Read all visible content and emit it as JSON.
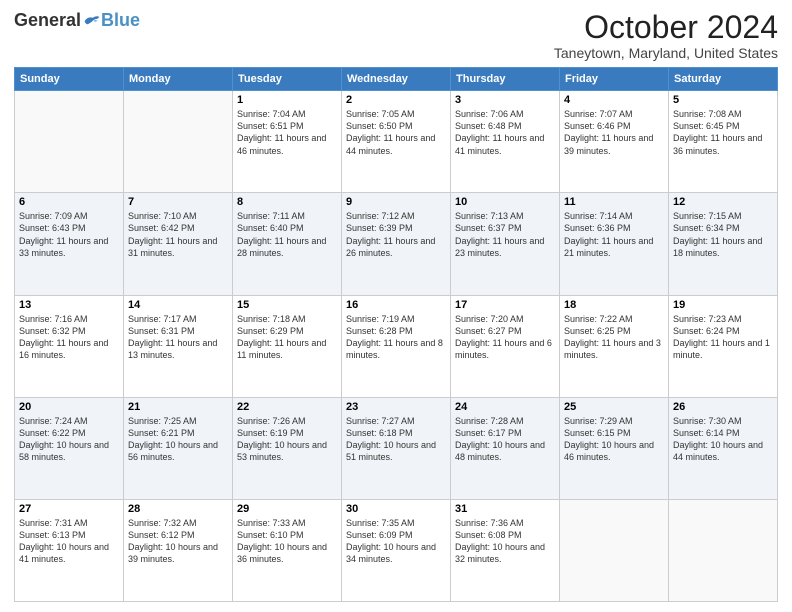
{
  "header": {
    "logo_general": "General",
    "logo_blue": "Blue",
    "month_title": "October 2024",
    "location": "Taneytown, Maryland, United States"
  },
  "calendar": {
    "days_of_week": [
      "Sunday",
      "Monday",
      "Tuesday",
      "Wednesday",
      "Thursday",
      "Friday",
      "Saturday"
    ],
    "weeks": [
      [
        {
          "day": "",
          "sunrise": "",
          "sunset": "",
          "daylight": ""
        },
        {
          "day": "",
          "sunrise": "",
          "sunset": "",
          "daylight": ""
        },
        {
          "day": "1",
          "sunrise": "Sunrise: 7:04 AM",
          "sunset": "Sunset: 6:51 PM",
          "daylight": "Daylight: 11 hours and 46 minutes."
        },
        {
          "day": "2",
          "sunrise": "Sunrise: 7:05 AM",
          "sunset": "Sunset: 6:50 PM",
          "daylight": "Daylight: 11 hours and 44 minutes."
        },
        {
          "day": "3",
          "sunrise": "Sunrise: 7:06 AM",
          "sunset": "Sunset: 6:48 PM",
          "daylight": "Daylight: 11 hours and 41 minutes."
        },
        {
          "day": "4",
          "sunrise": "Sunrise: 7:07 AM",
          "sunset": "Sunset: 6:46 PM",
          "daylight": "Daylight: 11 hours and 39 minutes."
        },
        {
          "day": "5",
          "sunrise": "Sunrise: 7:08 AM",
          "sunset": "Sunset: 6:45 PM",
          "daylight": "Daylight: 11 hours and 36 minutes."
        }
      ],
      [
        {
          "day": "6",
          "sunrise": "Sunrise: 7:09 AM",
          "sunset": "Sunset: 6:43 PM",
          "daylight": "Daylight: 11 hours and 33 minutes."
        },
        {
          "day": "7",
          "sunrise": "Sunrise: 7:10 AM",
          "sunset": "Sunset: 6:42 PM",
          "daylight": "Daylight: 11 hours and 31 minutes."
        },
        {
          "day": "8",
          "sunrise": "Sunrise: 7:11 AM",
          "sunset": "Sunset: 6:40 PM",
          "daylight": "Daylight: 11 hours and 28 minutes."
        },
        {
          "day": "9",
          "sunrise": "Sunrise: 7:12 AM",
          "sunset": "Sunset: 6:39 PM",
          "daylight": "Daylight: 11 hours and 26 minutes."
        },
        {
          "day": "10",
          "sunrise": "Sunrise: 7:13 AM",
          "sunset": "Sunset: 6:37 PM",
          "daylight": "Daylight: 11 hours and 23 minutes."
        },
        {
          "day": "11",
          "sunrise": "Sunrise: 7:14 AM",
          "sunset": "Sunset: 6:36 PM",
          "daylight": "Daylight: 11 hours and 21 minutes."
        },
        {
          "day": "12",
          "sunrise": "Sunrise: 7:15 AM",
          "sunset": "Sunset: 6:34 PM",
          "daylight": "Daylight: 11 hours and 18 minutes."
        }
      ],
      [
        {
          "day": "13",
          "sunrise": "Sunrise: 7:16 AM",
          "sunset": "Sunset: 6:32 PM",
          "daylight": "Daylight: 11 hours and 16 minutes."
        },
        {
          "day": "14",
          "sunrise": "Sunrise: 7:17 AM",
          "sunset": "Sunset: 6:31 PM",
          "daylight": "Daylight: 11 hours and 13 minutes."
        },
        {
          "day": "15",
          "sunrise": "Sunrise: 7:18 AM",
          "sunset": "Sunset: 6:29 PM",
          "daylight": "Daylight: 11 hours and 11 minutes."
        },
        {
          "day": "16",
          "sunrise": "Sunrise: 7:19 AM",
          "sunset": "Sunset: 6:28 PM",
          "daylight": "Daylight: 11 hours and 8 minutes."
        },
        {
          "day": "17",
          "sunrise": "Sunrise: 7:20 AM",
          "sunset": "Sunset: 6:27 PM",
          "daylight": "Daylight: 11 hours and 6 minutes."
        },
        {
          "day": "18",
          "sunrise": "Sunrise: 7:22 AM",
          "sunset": "Sunset: 6:25 PM",
          "daylight": "Daylight: 11 hours and 3 minutes."
        },
        {
          "day": "19",
          "sunrise": "Sunrise: 7:23 AM",
          "sunset": "Sunset: 6:24 PM",
          "daylight": "Daylight: 11 hours and 1 minute."
        }
      ],
      [
        {
          "day": "20",
          "sunrise": "Sunrise: 7:24 AM",
          "sunset": "Sunset: 6:22 PM",
          "daylight": "Daylight: 10 hours and 58 minutes."
        },
        {
          "day": "21",
          "sunrise": "Sunrise: 7:25 AM",
          "sunset": "Sunset: 6:21 PM",
          "daylight": "Daylight: 10 hours and 56 minutes."
        },
        {
          "day": "22",
          "sunrise": "Sunrise: 7:26 AM",
          "sunset": "Sunset: 6:19 PM",
          "daylight": "Daylight: 10 hours and 53 minutes."
        },
        {
          "day": "23",
          "sunrise": "Sunrise: 7:27 AM",
          "sunset": "Sunset: 6:18 PM",
          "daylight": "Daylight: 10 hours and 51 minutes."
        },
        {
          "day": "24",
          "sunrise": "Sunrise: 7:28 AM",
          "sunset": "Sunset: 6:17 PM",
          "daylight": "Daylight: 10 hours and 48 minutes."
        },
        {
          "day": "25",
          "sunrise": "Sunrise: 7:29 AM",
          "sunset": "Sunset: 6:15 PM",
          "daylight": "Daylight: 10 hours and 46 minutes."
        },
        {
          "day": "26",
          "sunrise": "Sunrise: 7:30 AM",
          "sunset": "Sunset: 6:14 PM",
          "daylight": "Daylight: 10 hours and 44 minutes."
        }
      ],
      [
        {
          "day": "27",
          "sunrise": "Sunrise: 7:31 AM",
          "sunset": "Sunset: 6:13 PM",
          "daylight": "Daylight: 10 hours and 41 minutes."
        },
        {
          "day": "28",
          "sunrise": "Sunrise: 7:32 AM",
          "sunset": "Sunset: 6:12 PM",
          "daylight": "Daylight: 10 hours and 39 minutes."
        },
        {
          "day": "29",
          "sunrise": "Sunrise: 7:33 AM",
          "sunset": "Sunset: 6:10 PM",
          "daylight": "Daylight: 10 hours and 36 minutes."
        },
        {
          "day": "30",
          "sunrise": "Sunrise: 7:35 AM",
          "sunset": "Sunset: 6:09 PM",
          "daylight": "Daylight: 10 hours and 34 minutes."
        },
        {
          "day": "31",
          "sunrise": "Sunrise: 7:36 AM",
          "sunset": "Sunset: 6:08 PM",
          "daylight": "Daylight: 10 hours and 32 minutes."
        },
        {
          "day": "",
          "sunrise": "",
          "sunset": "",
          "daylight": ""
        },
        {
          "day": "",
          "sunrise": "",
          "sunset": "",
          "daylight": ""
        }
      ]
    ]
  }
}
